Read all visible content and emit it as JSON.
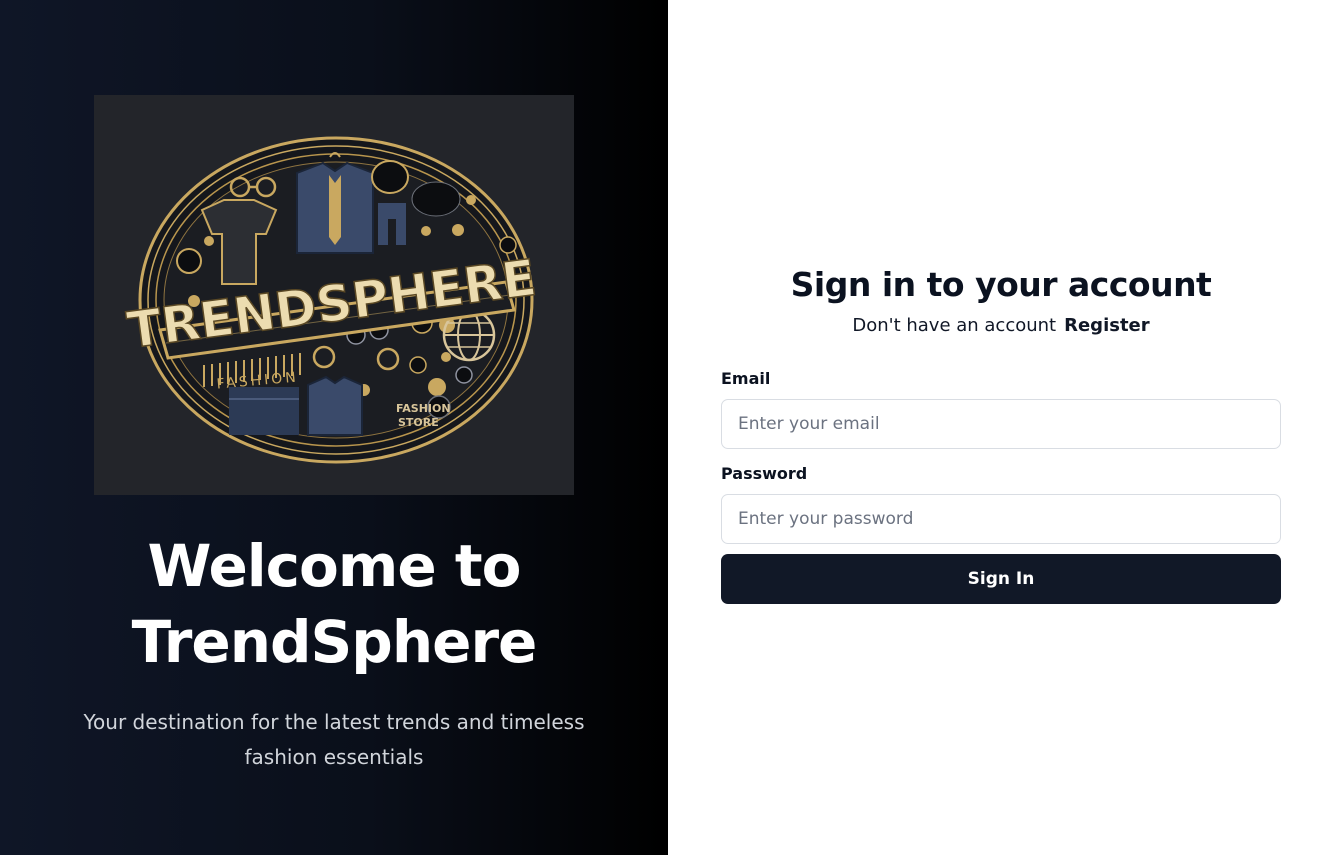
{
  "hero": {
    "logo": {
      "brand_text": "TRENDSPHERE",
      "sub_text": "FASHION",
      "badge_text_1": "FASHION",
      "badge_text_2": "STORE",
      "colors": {
        "background": "#23252a",
        "gold": "#c9a860",
        "navy": "#3a4a6a"
      }
    },
    "title_line_1": "Welcome to",
    "title_line_2": "TrendSphere",
    "tagline": "Your destination for the latest trends and timeless fashion essentials"
  },
  "auth": {
    "title": "Sign in to your account",
    "no_account_text": "Don't have an account",
    "register_link": "Register",
    "email_label": "Email",
    "email_placeholder": "Enter your email",
    "email_value": "",
    "password_label": "Password",
    "password_placeholder": "Enter your password",
    "password_value": "",
    "submit_label": "Sign In"
  },
  "colors": {
    "accent": "#111827",
    "hero_gradient_start": "#0f1627",
    "hero_gradient_end": "#000000"
  }
}
